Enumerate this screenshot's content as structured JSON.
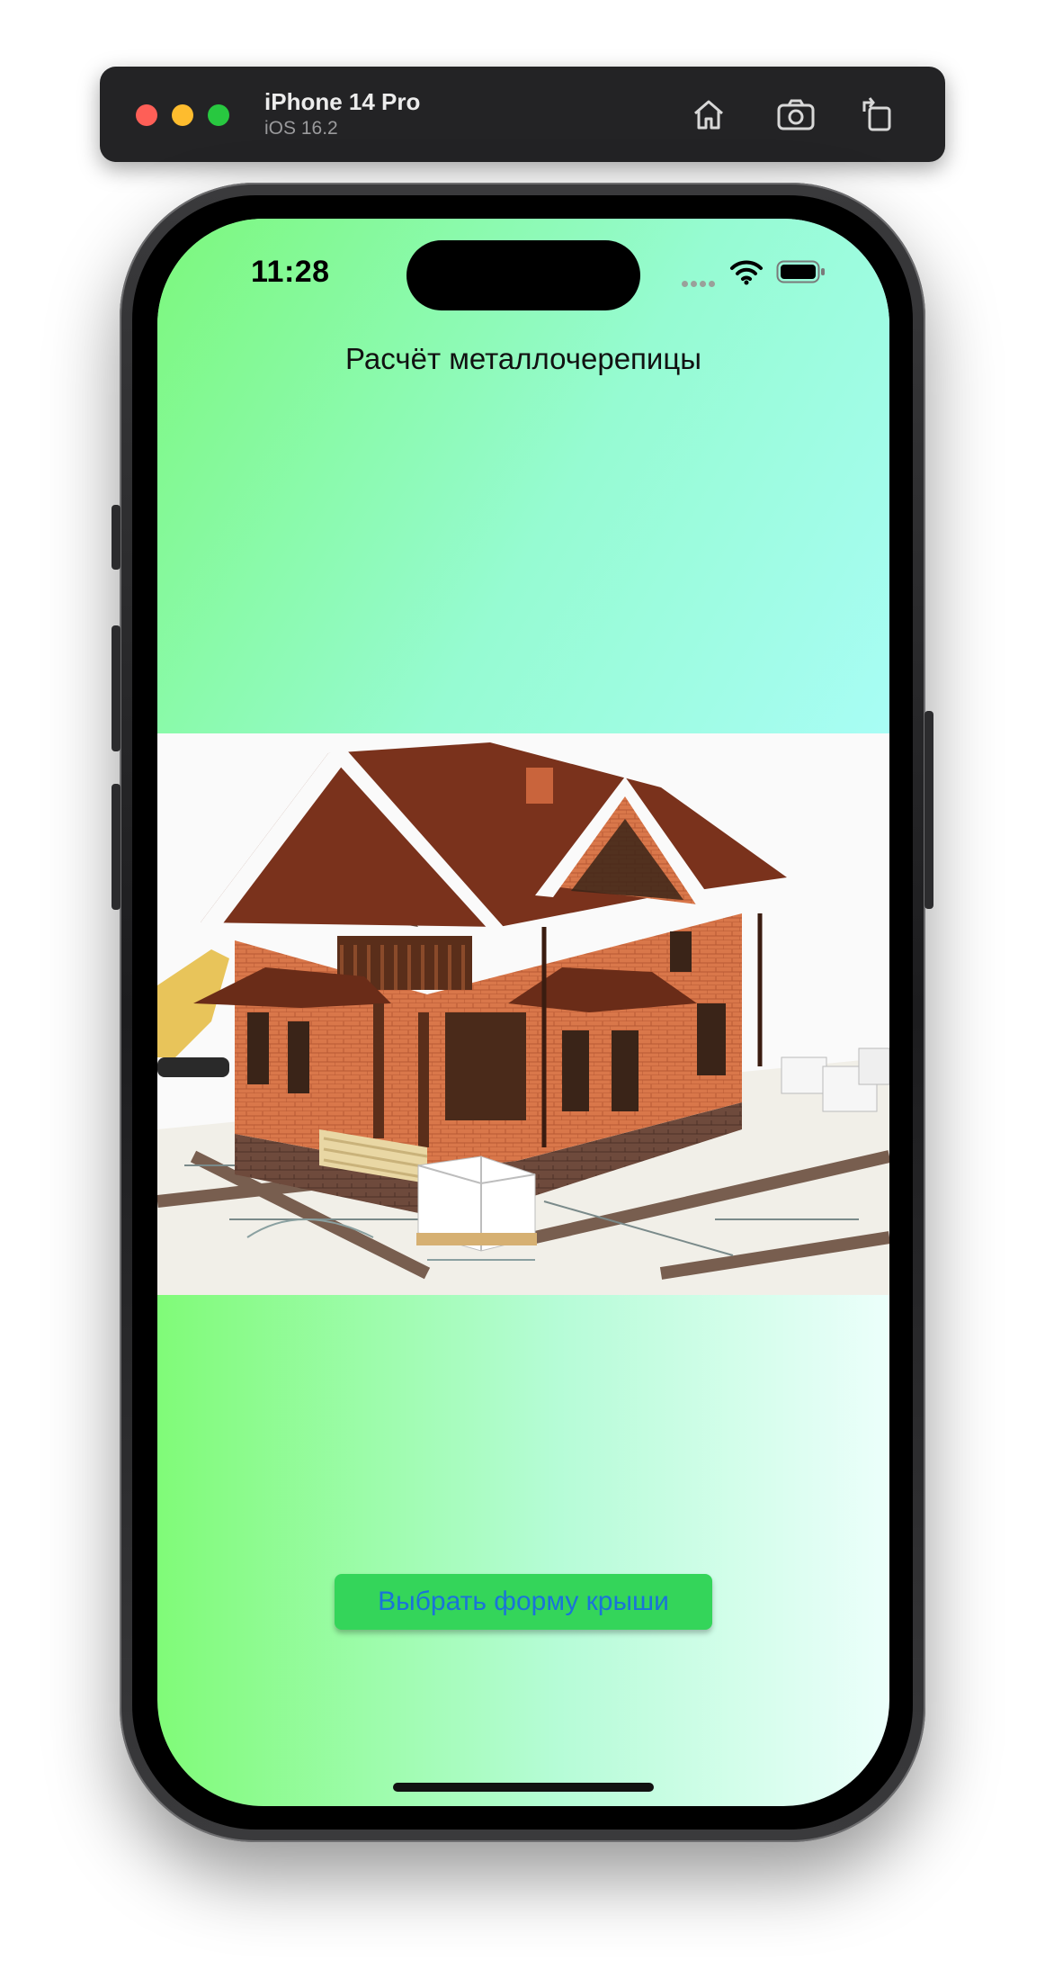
{
  "simulator": {
    "device_name": "iPhone 14 Pro",
    "os_version": "iOS 16.2",
    "icons": [
      "home-icon",
      "screenshot-icon",
      "rotate-icon"
    ],
    "traffic_lights": {
      "close": "#fe5f57",
      "minimize": "#febc2e",
      "zoom": "#28c840"
    }
  },
  "status_bar": {
    "time": "11:28",
    "icons": [
      "cellular-icon",
      "wifi-icon",
      "battery-icon"
    ]
  },
  "app": {
    "title": "Расчёт металлочерепицы",
    "image": "house-illustration",
    "button_label": "Выбрать форму крыши",
    "colors": {
      "background_start": "#80fb78",
      "background_end": "#ecfffb",
      "button_fill": "#34d55a",
      "button_text": "#1a73d9"
    }
  }
}
